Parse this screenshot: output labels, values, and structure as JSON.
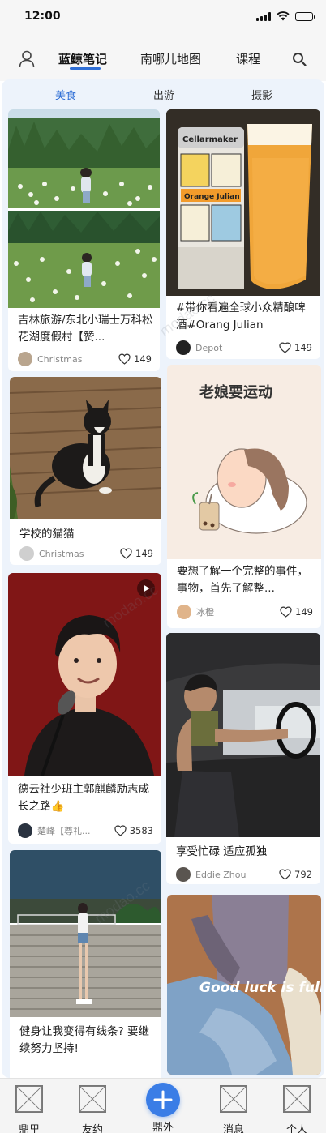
{
  "status": {
    "time": "12:00"
  },
  "top_nav": {
    "tabs": [
      {
        "label": "蓝鲸笔记",
        "active": true
      },
      {
        "label": "南哪儿地图",
        "active": false
      },
      {
        "label": "课程",
        "active": false
      }
    ],
    "icons": [
      "user-icon",
      "search-icon"
    ]
  },
  "sub_tabs": [
    {
      "label": "美食",
      "active": true
    },
    {
      "label": "出游",
      "active": false
    },
    {
      "label": "摄影",
      "active": false
    }
  ],
  "cards": [
    {
      "title": "吉林旅游/东北小瑞士万科松花湖度假村【赞...",
      "author": "Christmas",
      "likes": "149"
    },
    {
      "title": "#带你看遍全球小众精酿啤酒#Orang Julian",
      "author": "Depot",
      "likes": "149",
      "image_text": [
        "Cellarmaker",
        "Orange Julian"
      ]
    },
    {
      "title": "学校的猫猫",
      "author": "Christmas",
      "likes": "149"
    },
    {
      "title": "要想了解一个完整的事件，事物，首先了解整...",
      "author": "冰橙",
      "likes": "149",
      "image_text": [
        "老娘要运动"
      ]
    },
    {
      "title": "德云社少班主郭麒麟励志成长之路👍",
      "author": "楚峰【尊礼...",
      "likes": "3583"
    },
    {
      "title": "享受忙碌 适应孤独",
      "author": "Eddie Zhou",
      "likes": "792"
    },
    {
      "title": "健身让我变得有线条? 要继续努力坚持!",
      "author": "",
      "likes": ""
    },
    {
      "title": "",
      "author": "",
      "likes": "",
      "image_text": [
        "Good luck is full"
      ]
    }
  ],
  "watermark": "modao.cc",
  "bottom_tabs": [
    {
      "label": "鼎里"
    },
    {
      "label": "友约"
    },
    {
      "label": "鼎外",
      "icon": "plus-icon"
    },
    {
      "label": "消息"
    },
    {
      "label": "个人"
    }
  ],
  "colors": {
    "accent": "#2f6fd6",
    "panel_bg": "#edf3fb",
    "fab": "#3a7de6"
  }
}
